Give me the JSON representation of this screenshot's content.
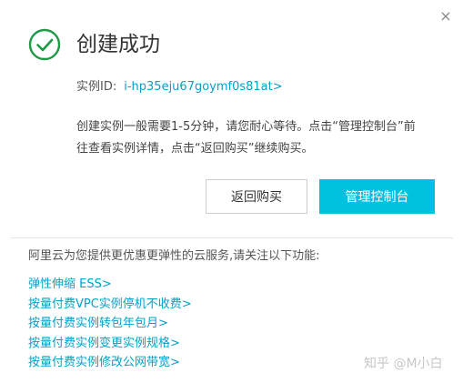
{
  "dialog": {
    "close_label": "×",
    "title": "创建成功",
    "instance_label": "实例ID:",
    "instance_id": "i-hp35eju67goymf0s81at>",
    "description": "创建实例一般需要1-5分钟，请您耐心等待。点击“管理控制台”前往查看实例详情，点击“返回购买”继续购买。",
    "back_button": "返回购买",
    "console_button": "管理控制台"
  },
  "promo": {
    "text": "阿里云为您提供更优惠更弹性的云服务,请关注以下功能:",
    "links": [
      "弹性伸缩 ESS>",
      "按量付费VPC实例停机不收费>",
      "按量付费实例转包年包月>",
      "按量付费实例变更实例规格>",
      "按量付费实例修改公网带宽>"
    ]
  },
  "watermark": "知乎 @M小白",
  "colors": {
    "accent": "#00c1de",
    "link": "#00a2ca",
    "success": "#1e9a47"
  }
}
